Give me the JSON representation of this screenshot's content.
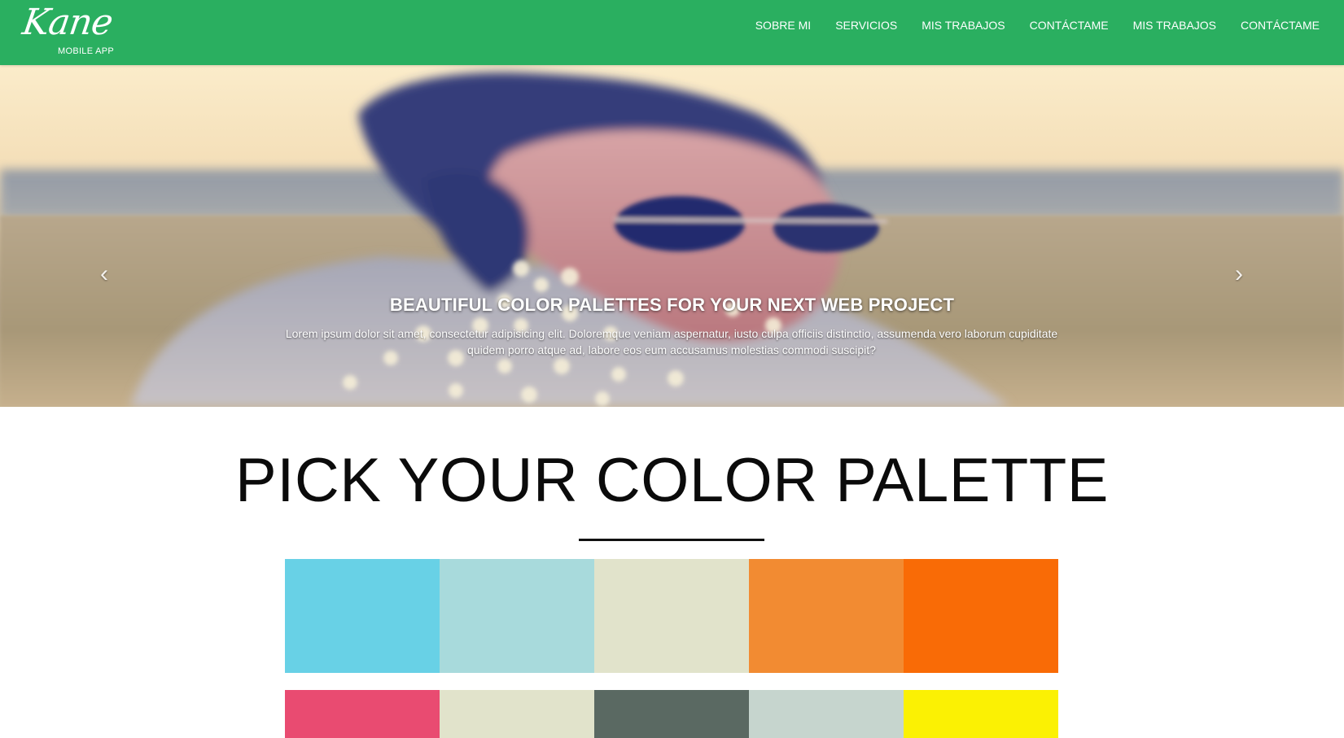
{
  "navbar": {
    "brand_name": "Kane",
    "brand_tagline": "MOBILE APP",
    "links": [
      "SOBRE MI",
      "SERVICIOS",
      "MIS TRABAJOS",
      "CONTÁCTAME",
      "MIS TRABAJOS",
      "CONTÁCTAME"
    ],
    "background": "#2aaf60"
  },
  "hero": {
    "title": "BEAUTIFUL COLOR PALETTES FOR YOUR NEXT WEB PROJECT",
    "text": "Lorem ipsum dolor sit amet, consectetur adipisicing elit. Doloremque veniam aspernatur, iusto culpa officiis distinctio, assumenda vero laborum cupiditate quidem porro atque ad, labore eos eum accusamus molestias commodi suscipit?",
    "prev_icon": "chevron-left-icon",
    "next_icon": "chevron-right-icon",
    "slide_count": 3,
    "active_slide": 3
  },
  "palette_section": {
    "title": "PICK YOUR COLOR PALETTE",
    "rows": [
      [
        "#68d1e6",
        "#a8dadc",
        "#e1e3cb",
        "#f28b32",
        "#f96b06"
      ],
      [
        "#e94b71",
        "#e1e3cb",
        "#5a6962",
        "#c6d5ce",
        "#fbf103"
      ]
    ]
  }
}
